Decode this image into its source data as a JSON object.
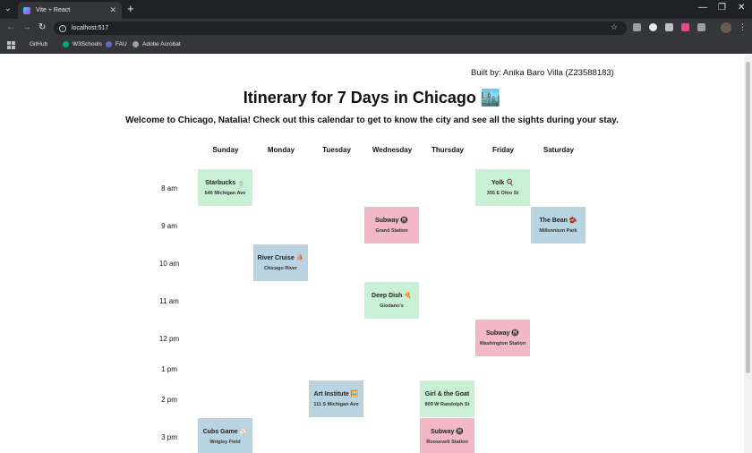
{
  "browser": {
    "tab_title": "Vite + React",
    "url": "localhost:517",
    "bookmarks": [
      {
        "label": "GitHub"
      },
      {
        "label": "W3Schools"
      },
      {
        "label": "FAU"
      },
      {
        "label": "Adobe Acrobat"
      }
    ]
  },
  "page": {
    "built_by": "Built by: Anika Baro Villa (Z23588183)",
    "title": "Itinerary for 7 Days in Chicago 🏙️",
    "welcome": "Welcome to Chicago, Natalia! Check out this calendar to get to know the city and see all the sights during your stay.",
    "days": [
      "Sunday",
      "Monday",
      "Tuesday",
      "Wednesday",
      "Thursday",
      "Friday",
      "Saturday"
    ],
    "times": [
      "8 am",
      "9 am",
      "10 am",
      "11 am",
      "12 pm",
      "1 pm",
      "2 pm",
      "3 pm"
    ],
    "events": [
      {
        "name": "Starbucks 🍵",
        "location": "646 Michigan Ave",
        "day": "Sunday",
        "time": "8 am",
        "color": "green"
      },
      {
        "name": "Yolk 🍳",
        "location": "355 E Ohio St",
        "day": "Friday",
        "time": "8 am",
        "color": "green"
      },
      {
        "name": "Subway 🚇",
        "location": "Grand Station",
        "day": "Wednesday",
        "time": "9 am",
        "color": "pink"
      },
      {
        "name": "The Bean 🫘",
        "location": "Millennium Park",
        "day": "Saturday",
        "time": "9 am",
        "color": "blue"
      },
      {
        "name": "River Cruise ⛵",
        "location": "Chicago River",
        "day": "Monday",
        "time": "10 am",
        "color": "blue"
      },
      {
        "name": "Deep Dish 🍕",
        "location": "Giodano's",
        "day": "Wednesday",
        "time": "11 am",
        "color": "green"
      },
      {
        "name": "Subway 🚇",
        "location": "Washington Station",
        "day": "Friday",
        "time": "12 pm",
        "color": "pink"
      },
      {
        "name": "Art Institute 🖼️",
        "location": "111 S Michigan Ave",
        "day": "Tuesday",
        "time": "2 pm",
        "color": "blue"
      },
      {
        "name": "Girl & the Goat",
        "location": "809 W Randolph St",
        "day": "Thursday",
        "time": "2 pm",
        "color": "green"
      },
      {
        "name": "Cubs Game ⚾",
        "location": "Wrigley Field",
        "day": "Sunday",
        "time": "3 pm",
        "color": "blue"
      },
      {
        "name": "Subway 🚇",
        "location": "Roosevelt Station",
        "day": "Thursday",
        "time": "3 pm",
        "color": "pink"
      }
    ]
  },
  "colors": {
    "green": "#c8f0d4",
    "pink": "#f2b8c8",
    "blue": "#b8d4e0",
    "browser_dark": "#202124",
    "browser_toolbar": "#35363a"
  }
}
